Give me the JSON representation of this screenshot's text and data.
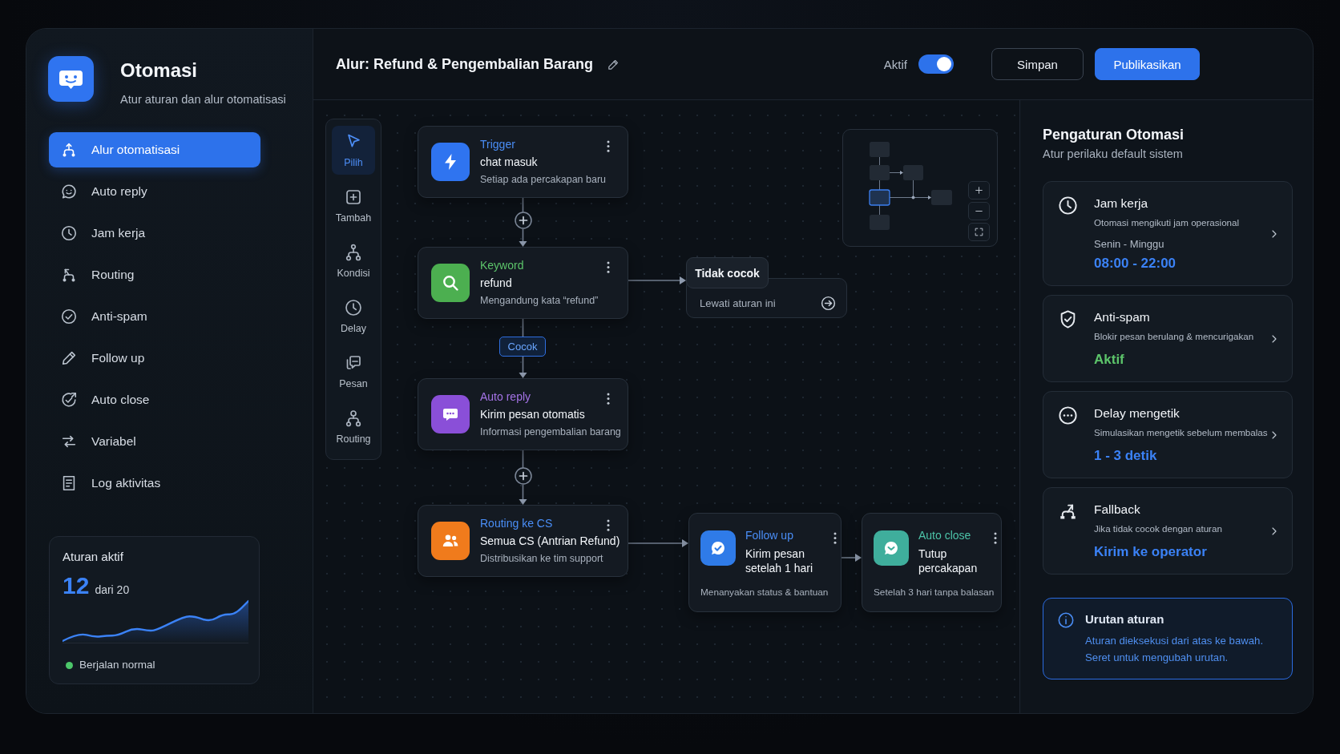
{
  "sidebar": {
    "app_title": "Otomasi",
    "app_subtitle": "Atur aturan dan alur otomatisasi",
    "nav": [
      {
        "label": "Alur otomatisasi",
        "selected": true
      },
      {
        "label": "Auto reply",
        "selected": false
      },
      {
        "label": "Jam kerja",
        "selected": false
      },
      {
        "label": "Routing",
        "selected": false
      },
      {
        "label": "Anti-spam",
        "selected": false
      },
      {
        "label": "Follow up",
        "selected": false
      },
      {
        "label": "Auto close",
        "selected": false
      },
      {
        "label": "Variabel",
        "selected": false
      },
      {
        "label": "Log aktivitas",
        "selected": false
      }
    ],
    "stats": {
      "title": "Aturan aktif",
      "value": "12",
      "total": "dari 20",
      "status": "Berjalan normal"
    }
  },
  "header": {
    "flow_title": "Alur: Refund & Pengembalian Barang",
    "active": {
      "label": "Aktif",
      "on": true
    },
    "buttons": [
      {
        "label": "Simpan",
        "kind": "secondary"
      },
      {
        "label": "Publikasikan",
        "kind": "primary"
      }
    ]
  },
  "tools": [
    {
      "label": "Pilih",
      "selected": true
    },
    {
      "label": "Tambah",
      "selected": false
    },
    {
      "label": "Kondisi",
      "selected": false
    },
    {
      "label": "Delay",
      "selected": false
    },
    {
      "label": "Pesan",
      "selected": false
    },
    {
      "label": "Routing",
      "selected": false
    }
  ],
  "canvas": {
    "nodes": [
      {
        "kind": "step",
        "type": {
          "text": "Trigger",
          "color": "#4a8ef7"
        },
        "title": "chat masuk",
        "description": "Setiap ada percakapan baru",
        "color": "#2f74f0"
      },
      {
        "kind": "step",
        "type": {
          "text": "Keyword",
          "color": "#5cc46a"
        },
        "title": "refund",
        "description": "Mengandung kata “refund”",
        "color": "#4caf50"
      },
      {
        "kind": "step",
        "type": {
          "text": "Auto reply",
          "color": "#a473e6"
        },
        "title": "Kirim pesan otomatis",
        "description": "Informasi pengembalian barang",
        "color": "#8a4fd8"
      },
      {
        "kind": "step",
        "type": {
          "text": "Routing ke CS",
          "color": "#4a8ef7"
        },
        "title": "Semua CS (Antrian Refund)",
        "description": "Distribusikan ke tim support",
        "color": "#f07b1c"
      },
      {
        "kind": "card",
        "type": {
          "text": "Follow up",
          "color": "#4a8ef7"
        },
        "title": "Kirim pesan setelah 1 hari",
        "description": "Menanyakan status & bantuan",
        "color": "#2f7be8"
      },
      {
        "kind": "card",
        "type": {
          "text": "Auto close",
          "color": "#4cc3a8"
        },
        "title": "Tutup percakapan",
        "description": "Setelah 3 hari tanpa balasan",
        "color": "#3fae9c"
      }
    ],
    "edge_label": "Cocok",
    "branch": {
      "label": "Tidak cocok",
      "description": "Lewati aturan ini"
    }
  },
  "settings": {
    "title": "Pengaturan Otomasi",
    "subtitle": "Atur perilaku default sistem",
    "items": [
      {
        "title": "Jam kerja",
        "description": "Otomasi mengikuti jam operasional",
        "detail": "Senin - Minggu",
        "value": "08:00 - 22:00",
        "color": "#3b82f6"
      },
      {
        "title": "Anti-spam",
        "description": "Blokir pesan berulang & mencurigakan",
        "value": "Aktif",
        "color": "#5cc46a"
      },
      {
        "title": "Delay mengetik",
        "description": "Simulasikan mengetik sebelum membalas",
        "value": "1 - 3 detik",
        "color": "#3b82f6"
      },
      {
        "title": "Fallback",
        "description": "Jika tidak cocok dengan aturan",
        "value": "Kirim ke operator",
        "color": "#3b82f6"
      }
    ],
    "info": {
      "title": "Urutan aturan",
      "lines": [
        "Aturan dieksekusi dari atas ke bawah.",
        "Seret untuk mengubah urutan."
      ]
    }
  }
}
